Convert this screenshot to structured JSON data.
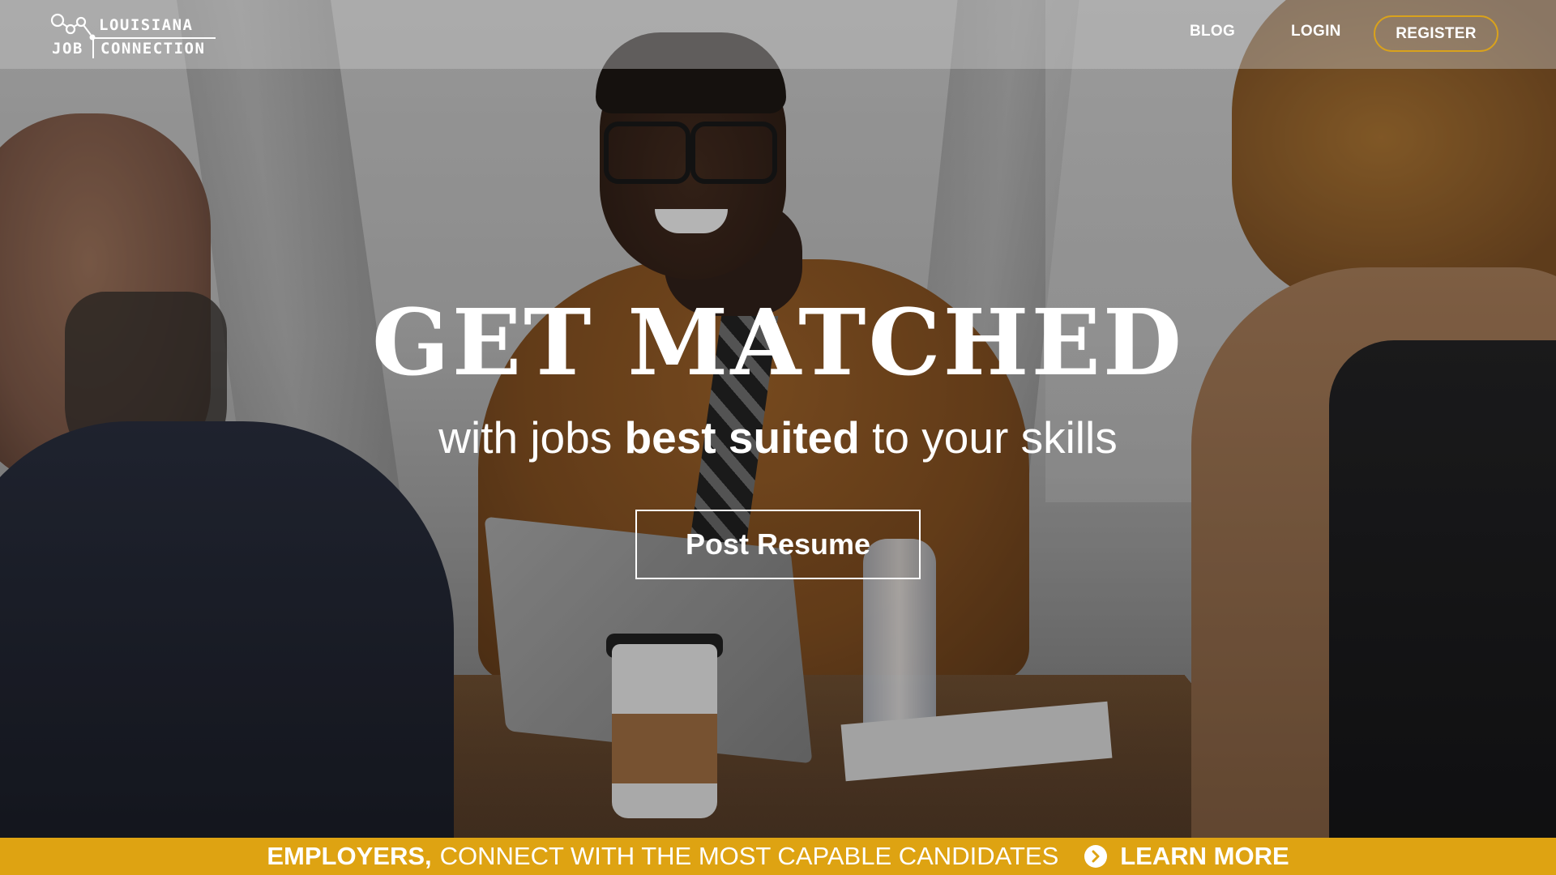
{
  "header": {
    "logo": {
      "line1": "LOUISIANA",
      "line2_left": "JOB",
      "line2_right": "CONNECTION"
    },
    "nav": {
      "blog": "BLOG",
      "login": "LOGIN",
      "register": "REGISTER"
    },
    "accent_color": "#d9a21c"
  },
  "hero": {
    "headline": "GET MATCHED",
    "subline_prefix": "with jobs ",
    "subline_strong": "best suited",
    "subline_suffix": " to your skills",
    "cta_label": "Post Resume"
  },
  "banner": {
    "strong": "EMPLOYERS,",
    "rest": "CONNECT WITH THE MOST CAPABLE CANDIDATES",
    "link_label": "LEARN MORE",
    "link_icon": "chevron-right-circle-icon",
    "background_color": "#dea312"
  }
}
